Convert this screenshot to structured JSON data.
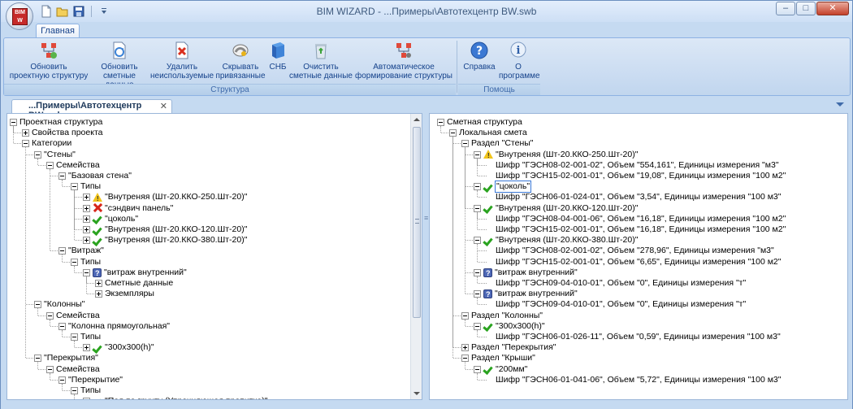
{
  "window": {
    "title": "BIM WIZARD - ...Примеры\\Автотехцентр BW.swb",
    "controls": {
      "minimize": "–",
      "maximize": "□",
      "close": "✕"
    }
  },
  "app_logo_text": "BIM W",
  "ribbon": {
    "tab": "Главная",
    "groups": [
      {
        "label": "Структура"
      },
      {
        "label": "Помощь"
      }
    ],
    "buttons": [
      {
        "label1": "Обновить",
        "label2": "проектную структуру",
        "icon": "update-project-structure-icon"
      },
      {
        "label1": "Обновить",
        "label2": "сметные данные",
        "icon": "update-estimate-icon"
      },
      {
        "label1": "Удалить",
        "label2": "неиспользуемые",
        "icon": "delete-unused-icon"
      },
      {
        "label1": "Скрывать",
        "label2": "привязанные",
        "icon": "hide-linked-icon"
      },
      {
        "label1": "СНБ",
        "label2": "",
        "icon": "book-icon"
      },
      {
        "label1": "Очистить",
        "label2": "сметные данные",
        "icon": "recycle-bin-icon"
      },
      {
        "label1": "Автоматическое",
        "label2": "формирование структуры",
        "icon": "auto-structure-icon"
      },
      {
        "label1": "Справка",
        "label2": "",
        "icon": "help-icon"
      },
      {
        "label1": "О",
        "label2": "программе",
        "icon": "info-icon"
      }
    ]
  },
  "document_tab": {
    "label": "...Примеры\\Автотехцентр BW.swb",
    "close": "✕"
  },
  "left_tree": [
    {
      "t": "Проектная структура",
      "lvl": 0,
      "tog": "minus"
    },
    {
      "t": "Свойства проекта",
      "lvl": 1,
      "tog": "plus"
    },
    {
      "t": "Категории",
      "lvl": 1,
      "tog": "minus"
    },
    {
      "t": "\"Стены\"",
      "lvl": 2,
      "tog": "minus"
    },
    {
      "t": "Семейства",
      "lvl": 3,
      "tog": "minus"
    },
    {
      "t": "\"Базовая стена\"",
      "lvl": 4,
      "tog": "minus"
    },
    {
      "t": "Типы",
      "lvl": 5,
      "tog": "minus"
    },
    {
      "t": "\"Внутреняя (Шт-20.ККО-250.Шт-20)\"",
      "lvl": 6,
      "tog": "plus",
      "ic": "warn"
    },
    {
      "t": "\"сэндвич панель\"",
      "lvl": 6,
      "tog": "plus",
      "ic": "x"
    },
    {
      "t": "\"цоколь\"",
      "lvl": 6,
      "tog": "plus",
      "ic": "check"
    },
    {
      "t": "\"Внутреняя (Шт-20.ККО-120.Шт-20)\"",
      "lvl": 6,
      "tog": "plus",
      "ic": "check"
    },
    {
      "t": "\"Внутреняя (Шт-20.ККО-380.Шт-20)\"",
      "lvl": 6,
      "tog": "plus",
      "ic": "check"
    },
    {
      "t": "\"Витраж\"",
      "lvl": 4,
      "tog": "minus"
    },
    {
      "t": "Типы",
      "lvl": 5,
      "tog": "minus"
    },
    {
      "t": "\"витраж внутренний\"",
      "lvl": 6,
      "tog": "minus",
      "ic": "q"
    },
    {
      "t": "Сметные данные",
      "lvl": 7,
      "tog": "plus"
    },
    {
      "t": "Экземпляры",
      "lvl": 7,
      "tog": "plus"
    },
    {
      "t": "\"Колонны\"",
      "lvl": 2,
      "tog": "minus"
    },
    {
      "t": "Семейства",
      "lvl": 3,
      "tog": "minus"
    },
    {
      "t": "\"Колонна прямоугольная\"",
      "lvl": 4,
      "tog": "minus"
    },
    {
      "t": "Типы",
      "lvl": 5,
      "tog": "minus"
    },
    {
      "t": "\"300x300(h)\"",
      "lvl": 6,
      "tog": "plus",
      "ic": "check"
    },
    {
      "t": "\"Перекрытия\"",
      "lvl": 2,
      "tog": "minus"
    },
    {
      "t": "Семейства",
      "lvl": 3,
      "tog": "minus"
    },
    {
      "t": "\"Перекрытие\"",
      "lvl": 4,
      "tog": "minus"
    },
    {
      "t": "Типы",
      "lvl": 5,
      "tog": "minus"
    },
    {
      "t": "\"Пол по грунту (Упрочняющая пропитка)\"",
      "lvl": 6,
      "tog": "plus",
      "ic": "check"
    }
  ],
  "right_tree": [
    {
      "t": "Сметная структура",
      "lvl": 0,
      "tog": "minus"
    },
    {
      "t": "Локальная смета",
      "lvl": 1,
      "tog": "minus"
    },
    {
      "t": "Раздел \"Стены\"",
      "lvl": 2,
      "tog": "minus"
    },
    {
      "t": "\"Внутреняя (Шт-20.ККО-250.Шт-20)\"",
      "lvl": 3,
      "tog": "minus",
      "ic": "warn"
    },
    {
      "t": "Шифр \"ГЭСН08-02-001-02\", Объем \"554,161\", Единицы измерения \"м3\"",
      "lvl": 4,
      "tog": "none"
    },
    {
      "t": "Шифр \"ГЭСН15-02-001-01\", Объем \"19,08\", Единицы измерения \"100 м2\"",
      "lvl": 4,
      "tog": "none"
    },
    {
      "t": "\"цоколь\"",
      "lvl": 3,
      "tog": "minus",
      "ic": "check",
      "sel": true
    },
    {
      "t": "Шифр \"ГЭСН06-01-024-01\", Объем \"3,54\", Единицы измерения \"100 м3\"",
      "lvl": 4,
      "tog": "none"
    },
    {
      "t": "\"Внутреняя (Шт-20.ККО-120.Шт-20)\"",
      "lvl": 3,
      "tog": "minus",
      "ic": "check"
    },
    {
      "t": "Шифр \"ГЭСН08-04-001-06\", Объем \"16,18\", Единицы измерения \"100 м2\"",
      "lvl": 4,
      "tog": "none"
    },
    {
      "t": "Шифр \"ГЭСН15-02-001-01\", Объем \"16,18\", Единицы измерения \"100 м2\"",
      "lvl": 4,
      "tog": "none"
    },
    {
      "t": "\"Внутреняя (Шт-20.ККО-380.Шт-20)\"",
      "lvl": 3,
      "tog": "minus",
      "ic": "check"
    },
    {
      "t": "Шифр \"ГЭСН08-02-001-02\", Объем \"278,96\", Единицы измерения \"м3\"",
      "lvl": 4,
      "tog": "none"
    },
    {
      "t": "Шифр \"ГЭСН15-02-001-01\", Объем \"6,65\", Единицы измерения \"100 м2\"",
      "lvl": 4,
      "tog": "none"
    },
    {
      "t": "\"витраж внутренний\"",
      "lvl": 3,
      "tog": "minus",
      "ic": "q"
    },
    {
      "t": "Шифр \"ГЭСН09-04-010-01\", Объем \"0\", Единицы измерения \"т\"",
      "lvl": 4,
      "tog": "none"
    },
    {
      "t": "\"витраж внутренний\"",
      "lvl": 3,
      "tog": "minus",
      "ic": "q"
    },
    {
      "t": "Шифр \"ГЭСН09-04-010-01\", Объем \"0\", Единицы измерения \"т\"",
      "lvl": 4,
      "tog": "none"
    },
    {
      "t": "Раздел \"Колонны\"",
      "lvl": 2,
      "tog": "minus"
    },
    {
      "t": "\"300x300(h)\"",
      "lvl": 3,
      "tog": "minus",
      "ic": "check"
    },
    {
      "t": "Шифр \"ГЭСН06-01-026-11\", Объем \"0,59\", Единицы измерения \"100 м3\"",
      "lvl": 4,
      "tog": "none"
    },
    {
      "t": "Раздел \"Перекрытия\"",
      "lvl": 2,
      "tog": "plus"
    },
    {
      "t": "Раздел \"Крыши\"",
      "lvl": 2,
      "tog": "minus"
    },
    {
      "t": "\"200мм\"",
      "lvl": 3,
      "tog": "minus",
      "ic": "check"
    },
    {
      "t": "Шифр \"ГЭСН06-01-041-06\", Объем \"5,72\", Единицы измерения \"100 м3\"",
      "lvl": 4,
      "tog": "none"
    }
  ]
}
